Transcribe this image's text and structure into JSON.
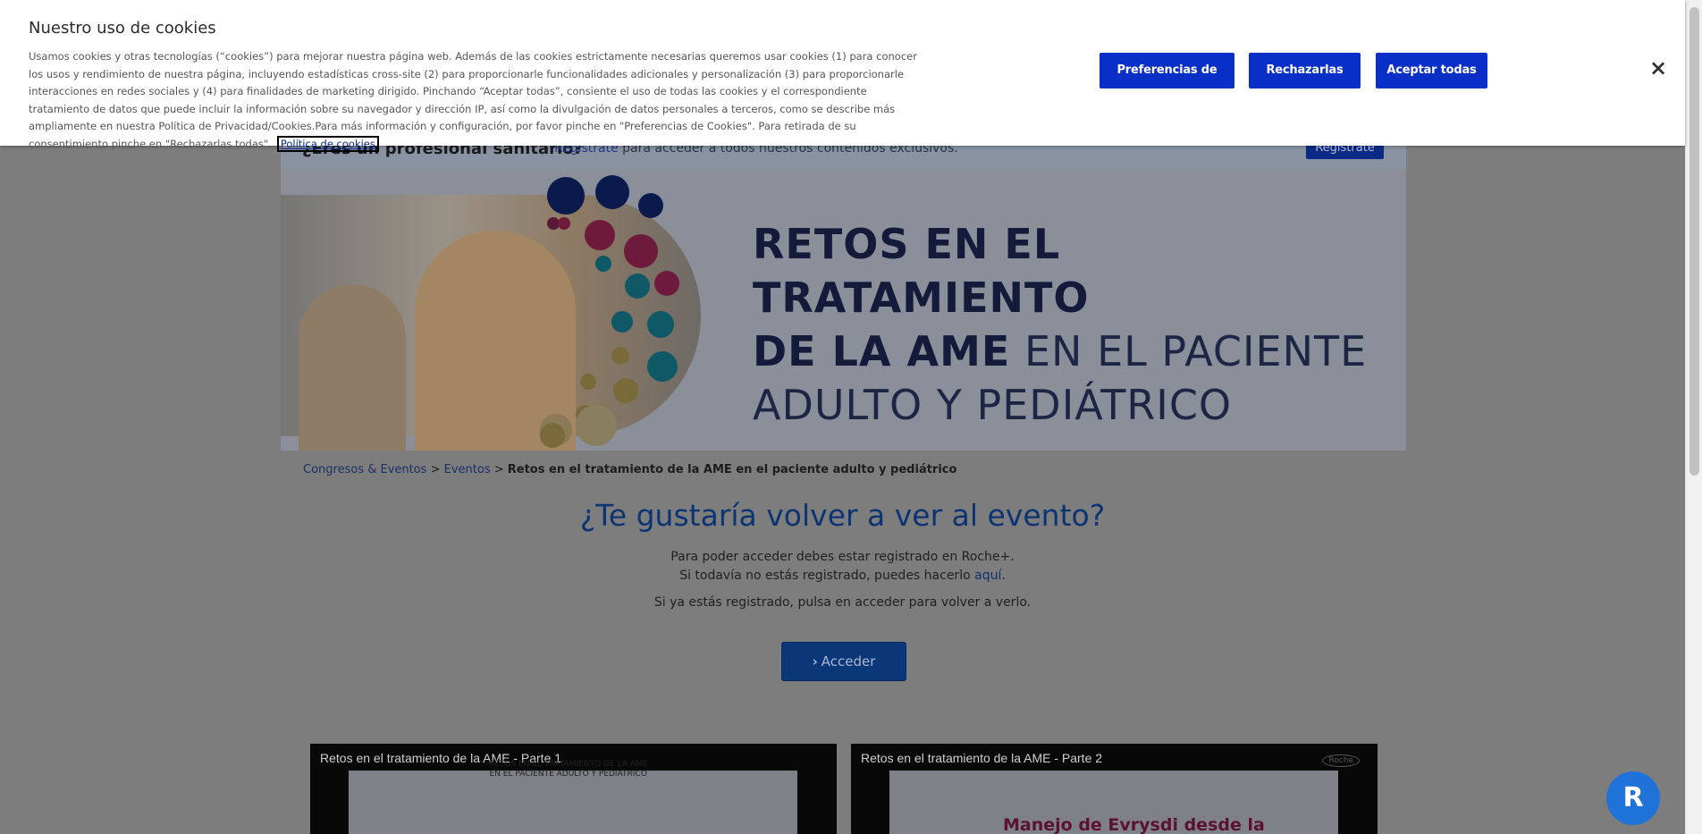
{
  "cookie_banner": {
    "title": "Nuestro uso de cookies",
    "body": "Usamos cookies y otras tecnologías (“cookies”) para mejorar nuestra página web. Además de las cookies estrictamente necesarias queremos usar cookies (1) para conocer los usos y rendimiento de nuestra página, incluyendo estadísticas cross-site (2) para proporcionarle funcionalidades adicionales y personalización (3) para proporcionarle interacciones en redes sociales y (4) para finalidades de marketing dirigido. Pinchando “Aceptar todas”, consiente el uso de todas las cookies y el correspondiente tratamiento de datos que puede incluir la información sobre su navegador y dirección IP, así como la divulgación de datos personales a terceros, como se describe más ampliamente en nuestra Política de Privacidad/Cookies.Para más información y configuración, por favor pinche en \"Preferencias de Cookies\". Para retirada de su consentimiento pinche en \"Rechazarlas todas\".",
    "policy_link": "Política de cookies",
    "preferences_button": "Preferencias de cookies",
    "reject_button": "Rechazarlas todas",
    "accept_button": "Aceptar todas",
    "close_icon": "×"
  },
  "pro_bar": {
    "question": "¿Eres un profesional sanitario?",
    "link": "Regístrate",
    "text": " para acceder a todos nuestros contenidos exclusivos.",
    "button": "Regístrate"
  },
  "banner": {
    "line1_bold": "RETOS EN EL TRATAMIENTO",
    "line2_bold": "DE LA AME",
    "line2_light": " EN EL PACIENTE",
    "line3_light": "ADULTO Y PEDIÁTRICO"
  },
  "breadcrumb": {
    "item1": "Congresos & Eventos",
    "sep1": " > ",
    "item2": "Eventos",
    "sep2": " > ",
    "current": "Retos en el tratamiento de la AME en el paciente adulto y pediátrico"
  },
  "main": {
    "title": "¿Te gustaría volver a ver al evento?",
    "line1": "Para poder acceder debes estar registrado en Roche+.",
    "line2": "Si todavía no estás registrado, puedes hacerlo ",
    "line2_link": "aquí",
    "line2_end": ".",
    "line3": "Si ya estás registrado, pulsa en acceder para volver a verlo.",
    "access_button": "Acceder",
    "access_icon": "chevron-right-icon"
  },
  "videos": [
    {
      "title": "Retos en el tratamiento de la AME - Parte 1",
      "overlay_line1": "RETOS EN EL TRATAMIENTO DE LA AME",
      "overlay_line2": "EN EL PACIENTE ADULTO Y PEDIÁTRICO"
    },
    {
      "title": "Retos en el tratamiento de la AME - Parte 2",
      "slide_text": "Manejo de Evrysdi desde la",
      "logo": "Roche"
    }
  ],
  "floating_button": {
    "icon": "roche-plus-icon",
    "glyph": "R"
  },
  "colors": {
    "cookie_button": "#0a2fc7",
    "headline_navy": "#0d2a6e",
    "float_button": "#1f73d8"
  }
}
